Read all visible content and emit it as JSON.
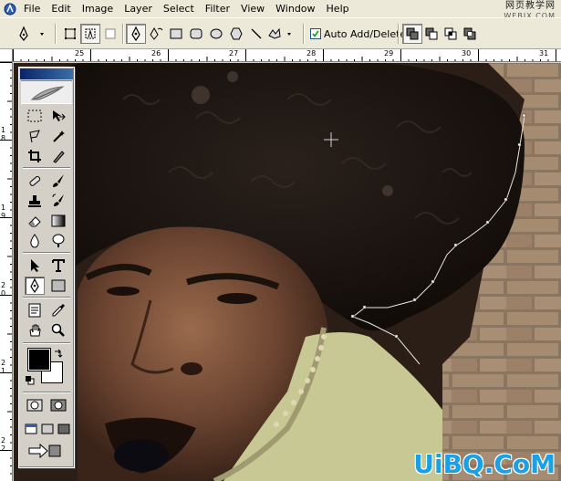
{
  "menu": {
    "items": [
      "File",
      "Edit",
      "Image",
      "Layer",
      "Select",
      "Filter",
      "View",
      "Window",
      "Help"
    ]
  },
  "watermark_top": {
    "line1": "网页教学网",
    "line2": "WEBJX.COM"
  },
  "options_bar": {
    "auto_add_delete_label": "Auto Add/Delete",
    "auto_add_delete_checked": true
  },
  "ruler_top": {
    "labels": [
      "25",
      "26",
      "27",
      "28",
      "29",
      "30",
      "31"
    ]
  },
  "ruler_left": {
    "labels": [
      "1",
      "8",
      "1",
      "9",
      "2",
      "0",
      "2",
      "1",
      "2",
      "2"
    ]
  },
  "watermark_bottom": {
    "text": "UiBQ.CoM"
  },
  "colors": {
    "accent": "#0a246a",
    "foreground_color": "#000000",
    "background_color": "#ffffff",
    "watermark": "#1aa0e6"
  },
  "icons": {
    "pen_tool": "pen-icon",
    "freeform_pen": "freeform-pen-icon",
    "rectangle": "rectangle-icon",
    "rounded_rectangle": "rounded-rectangle-icon",
    "ellipse": "ellipse-icon",
    "polygon": "polygon-icon",
    "line": "line-icon",
    "custom_shape": "custom-shape-icon"
  }
}
